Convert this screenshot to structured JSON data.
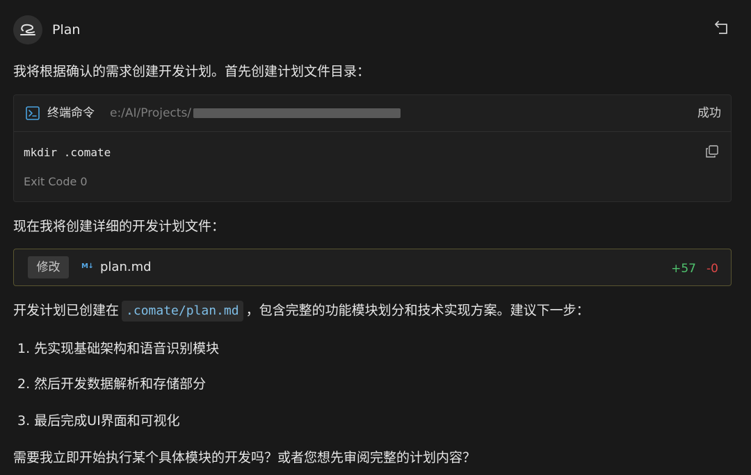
{
  "header": {
    "title": "Plan",
    "avatar_icon": "chat-wave-icon",
    "undo_icon": "undo-icon"
  },
  "messages": {
    "intro": "我将根据确认的需求创建开发计划。首先创建计划文件目录：",
    "terminal": {
      "label": "终端命令",
      "path": "e:/AI/Projects/",
      "status": "成功",
      "command": "mkdir .comate",
      "exit_code": "Exit Code 0"
    },
    "next": "现在我将创建详细的开发计划文件：",
    "file_change": {
      "action": "修改",
      "file_icon": "M↓",
      "file_name": "plan.md",
      "additions": "+57",
      "deletions": "-0"
    },
    "summary_before": "开发计划已创建在",
    "summary_code": ".comate/plan.md",
    "summary_after": "，包含完整的功能模块划分和技术实现方案。建议下一步：",
    "steps": [
      "1. 先实现基础架构和语音识别模块",
      "2. 然后开发数据解析和存储部分",
      "3. 最后完成UI界面和可视化"
    ],
    "question": "需要我立即开始执行某个具体模块的开发吗？或者您想先审阅完整的计划内容？"
  },
  "colors": {
    "background": "#191919",
    "card": "#1f1f1f",
    "code_text": "#7fbfe8",
    "additions": "#4fc36e",
    "deletions": "#e04848",
    "file_border": "#595530"
  }
}
